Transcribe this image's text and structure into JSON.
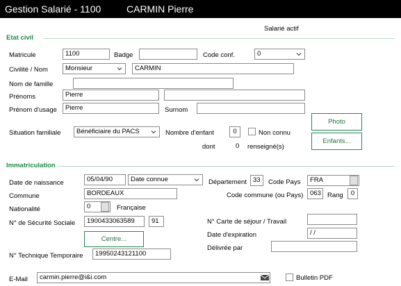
{
  "title": {
    "app": "Gestion Salarié - 1100",
    "person": "CARMIN Pierre"
  },
  "status": "Salarié actif",
  "etat_civil": {
    "section": "Etat civil",
    "matricule_label": "Matricule",
    "matricule": "1100",
    "badge_label": "Badge",
    "badge": "",
    "code_conf_label": "Code conf.",
    "code_conf": "0",
    "civilite_label": "Civilité /  Nom",
    "civilite": "Monsieur",
    "nom": "CARMIN",
    "nom_famille_label": "Nom de famille",
    "nom_famille": "",
    "prenoms_label": "Prénoms",
    "prenom1": "Pierre",
    "prenom2": "",
    "prenom_usage_label": "Prénom d'usage",
    "prenom_usage": "Pierre",
    "surnom_label": "Surnom",
    "surnom": "",
    "situation_label": "Situation familiale",
    "situation": "Bénéficiaire du PACS",
    "nb_enfant_label": "Nombre d'enfant",
    "nb_enfant": "0",
    "non_connu_label": "Non connu",
    "dont_label": "dont",
    "dont_value": "0",
    "renseigne_label": "renseigné(s)",
    "photo_button": "Photo",
    "enfants_button": "Enfants..."
  },
  "immatriculation": {
    "section": "Immatriculation",
    "naissance_label": "Date de naissance",
    "naissance": "05/04/90",
    "date_type": "Date connue",
    "departement_label": "Département",
    "departement": "33",
    "code_pays_label": "Code Pays",
    "code_pays": "FRA",
    "commune_label": "Commune",
    "commune": "BORDEAUX",
    "code_commune_label": "Code commune (ou Pays)",
    "code_commune": "063",
    "rang_label": "Rang",
    "rang": "0",
    "nationalite_label": "Nationalité",
    "nationalite_code": "0",
    "nationalite": "Française",
    "secu_label": "N° de Sécurité Sociale",
    "secu": "1900433063589",
    "secu_cle": "91",
    "centre_button": "Centre...",
    "carte_sejour_label": "N° Carte de séjour / Travail",
    "carte_sejour": "",
    "expiration_label": "Date d'expiration",
    "expiration": " / /",
    "delivree_label": "Délivrée par",
    "delivree": "",
    "tech_label": "N° Technique Temporaire",
    "tech": "19950243121100"
  },
  "contact": {
    "email_label": "E-Mail",
    "email": "carmin.pierre@i&i.com",
    "bulletin_label": "Bulletin PDF"
  },
  "colors": {
    "accent": "#1f8a4c",
    "titlebar": "#000000"
  }
}
